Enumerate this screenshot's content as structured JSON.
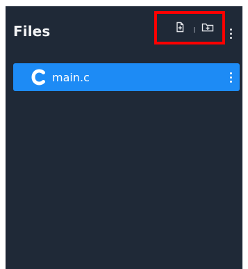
{
  "panel": {
    "title": "Files"
  },
  "toolbar": {
    "new_file_icon": "file-plus-icon",
    "new_folder_icon": "folder-plus-icon",
    "more_icon": "kebab-menu-icon"
  },
  "files": [
    {
      "name": "main.c",
      "icon": "c-language-icon",
      "selected": true,
      "menu_icon": "kebab-menu-icon"
    }
  ],
  "colors": {
    "panel_bg": "#1f2937",
    "selected_row_bg": "#1d8bf5",
    "highlight_border": "#ff0000",
    "text": "#f3f4f6"
  }
}
